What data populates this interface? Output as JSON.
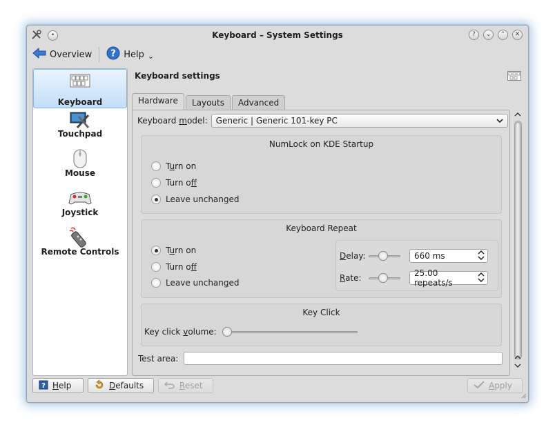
{
  "window": {
    "title": "Keyboard – System Settings"
  },
  "toolbar": {
    "overview_label": "Overview",
    "help_label": "Help",
    "help_menu_indicator": "⌄"
  },
  "title_buttons": {
    "help": "?",
    "minimize": "⌄",
    "maximize": "⌃",
    "close": "✕"
  },
  "sidebar": {
    "items": [
      {
        "label": "Keyboard",
        "icon": "keyboard-icon",
        "selected": true
      },
      {
        "label": "Touchpad",
        "icon": "touchpad-icon",
        "selected": false
      },
      {
        "label": "Mouse",
        "icon": "mouse-icon",
        "selected": false
      },
      {
        "label": "Joystick",
        "icon": "joystick-icon",
        "selected": false
      },
      {
        "label": "Remote Controls",
        "icon": "remote-control-icon",
        "selected": false
      }
    ]
  },
  "main": {
    "heading": "Keyboard settings",
    "tabs": [
      {
        "label": "Hardware",
        "active": true
      },
      {
        "label": "Layouts",
        "active": false
      },
      {
        "label": "Advanced",
        "active": false
      }
    ],
    "model": {
      "label_pre": "Keyboard ",
      "label_u": "m",
      "label_post": "odel:",
      "value": "Generic | Generic 101-key PC"
    },
    "numlock": {
      "title": "NumLock on KDE Startup",
      "options": [
        {
          "pre": "T",
          "u": "u",
          "post": "rn on",
          "checked": false
        },
        {
          "pre": "Turn o",
          "u": "f",
          "post": "f",
          "checked": false
        },
        {
          "pre": "Leave unchan",
          "u": "g",
          "post": "ed",
          "checked": true
        }
      ]
    },
    "repeat": {
      "title": "Keyboard Repeat",
      "options": [
        {
          "pre": "T",
          "u": "u",
          "post": "rn on",
          "checked": true
        },
        {
          "pre": "Turn o",
          "u": "f",
          "post": "f",
          "checked": false
        },
        {
          "pre": "Leave unchan",
          "u": "g",
          "post": "ed",
          "checked": false
        }
      ],
      "delay": {
        "u": "D",
        "post": "elay:",
        "value": "660 ms",
        "slider_fraction": 0.45
      },
      "rate": {
        "u": "R",
        "post": "ate:",
        "value": "25.00 repeats/s",
        "slider_fraction": 0.45
      }
    },
    "keyclick": {
      "title": "Key Click",
      "label_pre": "Key click ",
      "label_u": "v",
      "label_post": "olume:",
      "volume_fraction": 0.0
    },
    "test_area": {
      "label": "Test area:",
      "value": ""
    }
  },
  "bottom": {
    "help": {
      "u": "H",
      "post": "elp"
    },
    "defaults": {
      "u": "D",
      "post": "efaults"
    },
    "reset": {
      "u": "R",
      "post": "eset"
    },
    "apply": {
      "u": "A",
      "post": "pply"
    }
  },
  "colors": {
    "selection": "#c3ddf6",
    "window_bg": "#dcdcdc",
    "glow": "#5b9bd5"
  }
}
